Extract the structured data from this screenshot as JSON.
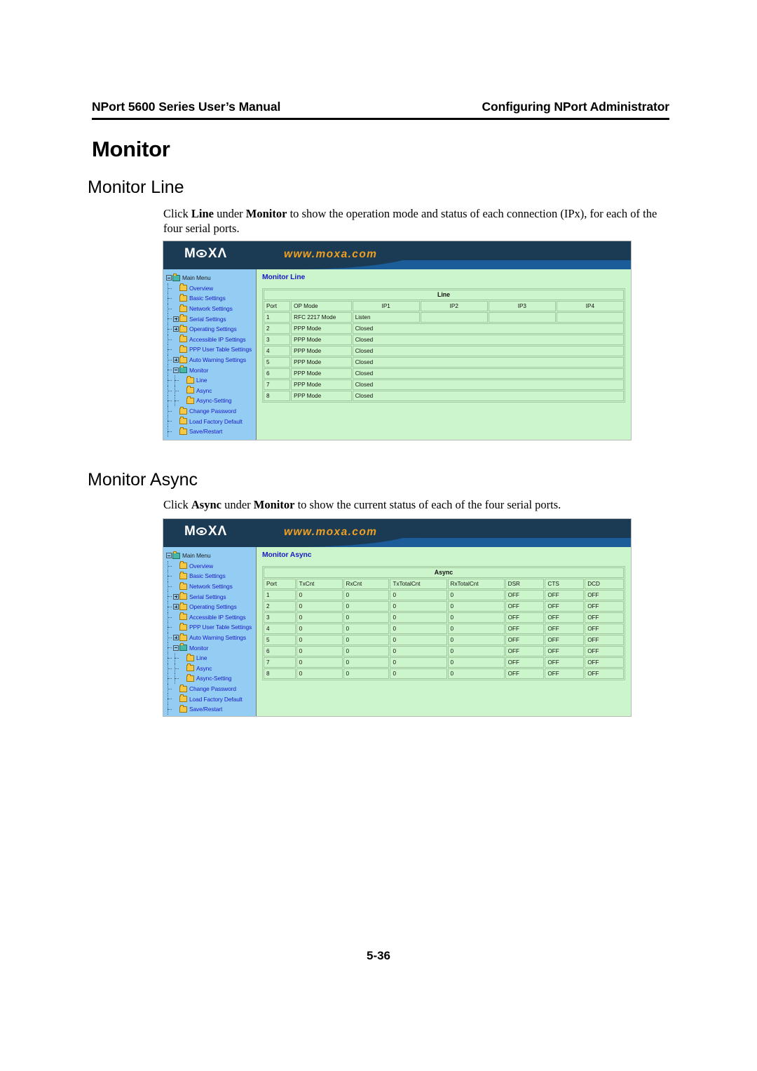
{
  "page": {
    "header_left": "NPort 5600 Series User’s Manual",
    "header_right": "Configuring NPort Administrator",
    "footer": "5-36",
    "h1": "Monitor"
  },
  "sections": {
    "line": {
      "heading": "Monitor Line",
      "paragraph_html": "Click <b>Line</b> under <b>Monitor</b> to show the operation mode and status of each connection (IPx), for each of the four serial ports."
    },
    "async": {
      "heading": "Monitor Async",
      "paragraph_html": "Click <b>Async</b> under <b>Monitor</b> to show the current status of each of the four serial ports."
    }
  },
  "banner": {
    "logo_pre": "M",
    "logo_post": "X",
    "logo_tail": "Λ",
    "url": "www.moxa.com",
    "bg_dark": "#1b3b55",
    "bg_light": "#1b5d98",
    "url_color": "#f0a020"
  },
  "sidebar": {
    "bg_color": "#93cdf3",
    "link_color": "#1a19c8",
    "items": [
      {
        "label": "Main Menu",
        "level": 0,
        "expander": "minus",
        "icon": "open-folder-icon",
        "root": true
      },
      {
        "label": "Overview",
        "level": 1,
        "expander": "none",
        "icon": "folder-icon"
      },
      {
        "label": "Basic Settings",
        "level": 1,
        "expander": "none",
        "icon": "folder-icon"
      },
      {
        "label": "Network Settings",
        "level": 1,
        "expander": "none",
        "icon": "folder-icon"
      },
      {
        "label": "Serial Settings",
        "level": 1,
        "expander": "plus",
        "icon": "folder-icon"
      },
      {
        "label": "Operating Settings",
        "level": 1,
        "expander": "plus",
        "icon": "folder-icon"
      },
      {
        "label": "Accessible IP Settings",
        "level": 1,
        "expander": "none",
        "icon": "folder-icon"
      },
      {
        "label": "PPP User Table Settings",
        "level": 1,
        "expander": "none",
        "icon": "folder-icon"
      },
      {
        "label": "Auto Warning Settings",
        "level": 1,
        "expander": "plus",
        "icon": "folder-icon"
      },
      {
        "label": "Monitor",
        "level": 1,
        "expander": "minus",
        "icon": "open-folder-icon"
      },
      {
        "label": "Line",
        "level": 2,
        "expander": "none",
        "icon": "folder-icon"
      },
      {
        "label": "Async",
        "level": 2,
        "expander": "none",
        "icon": "folder-icon"
      },
      {
        "label": "Async-Setting",
        "level": 2,
        "expander": "none",
        "icon": "folder-icon"
      },
      {
        "label": "Change Password",
        "level": 1,
        "expander": "none",
        "icon": "folder-icon"
      },
      {
        "label": "Load Factory Default",
        "level": 1,
        "expander": "none",
        "icon": "folder-icon"
      },
      {
        "label": "Save/Restart",
        "level": 1,
        "expander": "none",
        "icon": "folder-icon"
      }
    ]
  },
  "line_page": {
    "title": "Monitor Line",
    "table": {
      "caption": "Line",
      "columns": [
        "Port",
        "OP Mode",
        "IP1",
        "IP2",
        "IP3",
        "IP4"
      ],
      "rows": [
        {
          "port": "1",
          "op_mode": "RFC 2217 Mode",
          "ip1": "Listen",
          "ip2": "",
          "ip3": "",
          "ip4": "",
          "span": false
        },
        {
          "port": "2",
          "op_mode": "PPP Mode",
          "status": "Closed",
          "span": true
        },
        {
          "port": "3",
          "op_mode": "PPP Mode",
          "status": "Closed",
          "span": true
        },
        {
          "port": "4",
          "op_mode": "PPP Mode",
          "status": "Closed",
          "span": true
        },
        {
          "port": "5",
          "op_mode": "PPP Mode",
          "status": "Closed",
          "span": true
        },
        {
          "port": "6",
          "op_mode": "PPP Mode",
          "status": "Closed",
          "span": true
        },
        {
          "port": "7",
          "op_mode": "PPP Mode",
          "status": "Closed",
          "span": true
        },
        {
          "port": "8",
          "op_mode": "PPP Mode",
          "status": "Closed",
          "span": true
        }
      ]
    }
  },
  "async_page": {
    "title": "Monitor Async",
    "table": {
      "caption": "Async",
      "columns": [
        "Port",
        "TxCnt",
        "RxCnt",
        "TxTotalCnt",
        "RxTotalCnt",
        "DSR",
        "CTS",
        "DCD"
      ],
      "rows": [
        [
          "1",
          "0",
          "0",
          "0",
          "0",
          "OFF",
          "OFF",
          "OFF"
        ],
        [
          "2",
          "0",
          "0",
          "0",
          "0",
          "OFF",
          "OFF",
          "OFF"
        ],
        [
          "3",
          "0",
          "0",
          "0",
          "0",
          "OFF",
          "OFF",
          "OFF"
        ],
        [
          "4",
          "0",
          "0",
          "0",
          "0",
          "OFF",
          "OFF",
          "OFF"
        ],
        [
          "5",
          "0",
          "0",
          "0",
          "0",
          "OFF",
          "OFF",
          "OFF"
        ],
        [
          "6",
          "0",
          "0",
          "0",
          "0",
          "OFF",
          "OFF",
          "OFF"
        ],
        [
          "7",
          "0",
          "0",
          "0",
          "0",
          "OFF",
          "OFF",
          "OFF"
        ],
        [
          "8",
          "0",
          "0",
          "0",
          "0",
          "OFF",
          "OFF",
          "OFF"
        ]
      ]
    }
  }
}
